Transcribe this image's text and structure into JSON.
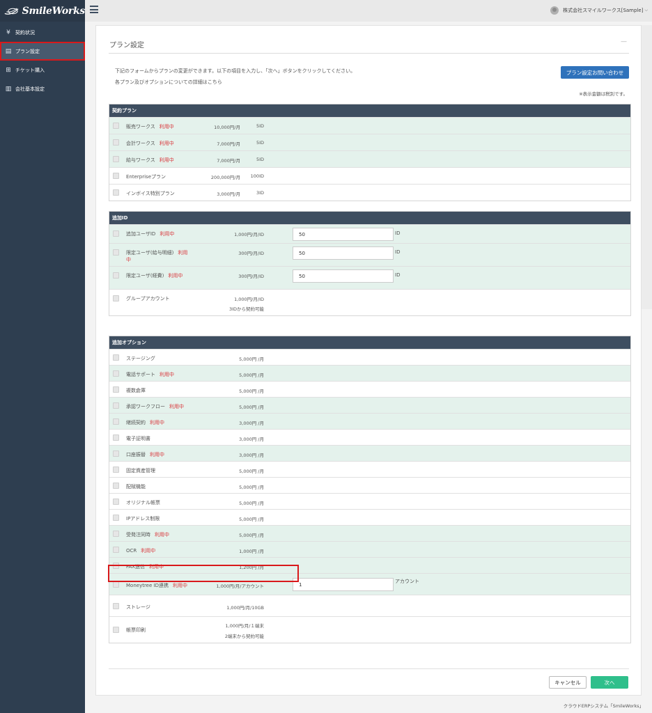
{
  "brand": {
    "logo_text": "SmileWorks"
  },
  "sidebar": {
    "items": [
      {
        "icon": "yen-icon",
        "glyph": "¥",
        "label": "契約状況",
        "active": false
      },
      {
        "icon": "list-icon",
        "glyph": "▤",
        "label": "プラン設定",
        "active": true
      },
      {
        "icon": "ticket-icon",
        "glyph": "⊞",
        "label": "チケット購入",
        "active": false
      },
      {
        "icon": "building-icon",
        "glyph": "▥",
        "label": "会社基本設定",
        "active": false
      }
    ]
  },
  "header": {
    "user_name": "株式会社スマイルワークス[Sample]"
  },
  "page": {
    "title": "プラン設定",
    "collapse": "—",
    "description_1": "下記のフォームからプランの変更ができます。以下の項目を入力し、「次へ」ボタンをクリックしてください。",
    "description_2": "各プラン及びオプションについての詳細はこちら",
    "inquiry_button": "プラン設定お問い合わせ",
    "tax_note": "※表示金額は税別です。",
    "in_use": "利用中"
  },
  "contract_plan": {
    "heading": "契約プラン",
    "rows": [
      {
        "name": "販売ワークス",
        "in_use": true,
        "price": "10,000円/月",
        "ids": "5ID"
      },
      {
        "name": "会計ワークス",
        "in_use": true,
        "price": "7,000円/月",
        "ids": "5ID"
      },
      {
        "name": "給与ワークス",
        "in_use": true,
        "price": "7,000円/月",
        "ids": "5ID"
      },
      {
        "name": "Enterpriseプラン",
        "in_use": false,
        "price": "200,000円/月",
        "ids": "100ID"
      },
      {
        "name": "インボイス特別プラン",
        "in_use": false,
        "price": "3,000円/月",
        "ids": "3ID"
      }
    ]
  },
  "additional_id": {
    "heading": "追加ID",
    "unit": "ID",
    "rows": [
      {
        "name": "追加ユーザID",
        "in_use": true,
        "price": "1,000円/月/ID",
        "value": "50"
      },
      {
        "name": "限定ユーザ(給与明細)",
        "in_use": true,
        "price": "300円/月/ID",
        "value": "50"
      },
      {
        "name": "限定ユーザ(経費)",
        "in_use": true,
        "price": "300円/月/ID",
        "value": "50"
      },
      {
        "name": "グループアカウント",
        "in_use": false,
        "price": "1,000円/月/ID",
        "sub": "3IDから契約可能"
      }
    ]
  },
  "options": {
    "heading": "追加オプション",
    "account_unit": "アカウント",
    "rows": [
      {
        "name": "ステージング",
        "in_use": false,
        "price": "5,000円 /月"
      },
      {
        "name": "電話サポート",
        "in_use": true,
        "price": "5,000円 /月"
      },
      {
        "name": "複数倉庫",
        "in_use": false,
        "price": "5,000円 /月"
      },
      {
        "name": "承認ワークフロー",
        "in_use": true,
        "price": "5,000円 /月"
      },
      {
        "name": "継続契約",
        "in_use": true,
        "price": "3,000円 /月"
      },
      {
        "name": "電子証明書",
        "in_use": false,
        "price": "3,000円 /月"
      },
      {
        "name": "口座振替",
        "in_use": true,
        "price": "3,000円 /月"
      },
      {
        "name": "固定資産管理",
        "in_use": false,
        "price": "5,000円 /月"
      },
      {
        "name": "配賦機能",
        "in_use": false,
        "price": "5,000円 /月"
      },
      {
        "name": "オリジナル帳票",
        "in_use": false,
        "price": "5,000円 /月"
      },
      {
        "name": "IPアドレス制限",
        "in_use": false,
        "price": "5,000円 /月"
      },
      {
        "name": "受発注同時",
        "in_use": true,
        "price": "5,000円 /月"
      },
      {
        "name": "OCR",
        "in_use": true,
        "price": "1,000円 /月"
      },
      {
        "name": "FAX送信",
        "in_use": true,
        "price": "1,200円 /月"
      },
      {
        "name": "Moneytree ID連携",
        "in_use": true,
        "price": "1,000円/月/アカウント",
        "value": "1"
      },
      {
        "name": "ストレージ",
        "in_use": false,
        "price": "1,000円/月/10GB"
      },
      {
        "name": "帳票印刷",
        "in_use": false,
        "price": "1,000円/月/１端末",
        "sub": "2端末から契約可能"
      }
    ]
  },
  "footer": {
    "cancel": "キャンセル",
    "next": "次へ",
    "copyright": "クラウドERPシステム「SmileWorks」"
  },
  "colors": {
    "sidebar_bg": "#2e3e50",
    "section_header": "#3e4e60",
    "row_in_use": "#e4f2ec",
    "in_use_text": "#d9353a",
    "inquiry_button": "#2f72bb",
    "next_button": "#2fbf8b",
    "highlight": "#d9191b"
  }
}
